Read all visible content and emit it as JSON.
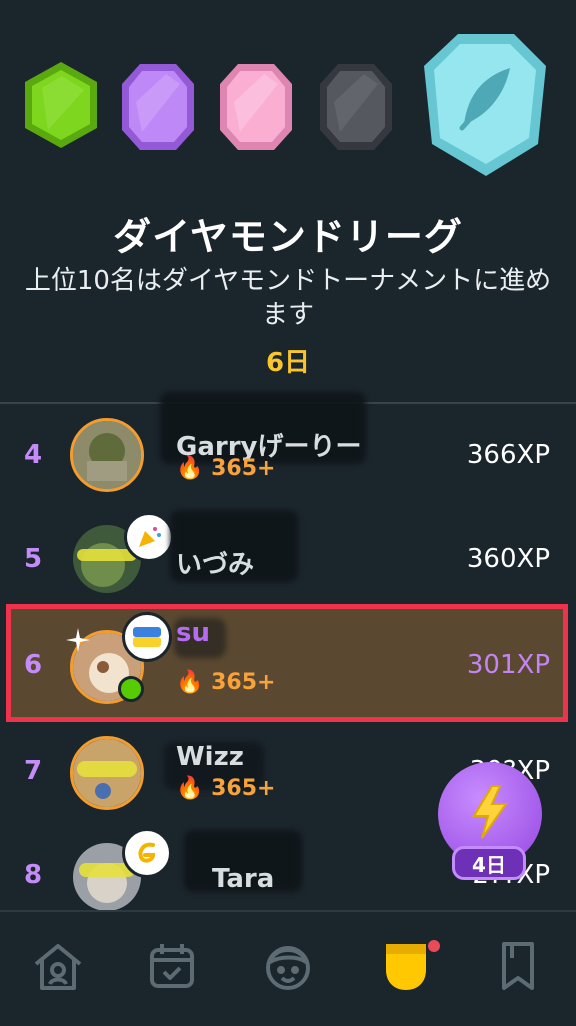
{
  "league": {
    "title": "ダイヤモンドリーグ",
    "subtitle": "上位10名はダイヤモンドトーナメントに進めます",
    "days_left": "6日",
    "gems": [
      {
        "name": "green",
        "color": "#74d317"
      },
      {
        "name": "purple",
        "color": "#b97cf4"
      },
      {
        "name": "pink",
        "color": "#f7a9cd"
      },
      {
        "name": "dark",
        "color": "#4c4f55"
      },
      {
        "name": "diamond",
        "color": "#8fe6ee"
      }
    ]
  },
  "leaderboard": [
    {
      "rank": "4",
      "name": "Garryげーりー",
      "streak": "365+",
      "xp": "366XP"
    },
    {
      "rank": "5",
      "name": "いづみ",
      "streak": "",
      "xp": "360XP"
    },
    {
      "rank": "6",
      "name": "su",
      "streak": "365+",
      "xp": "301XP",
      "highlighted": true
    },
    {
      "rank": "7",
      "name": "Wizz",
      "streak": "365+",
      "xp": "30?XP"
    },
    {
      "rank": "8",
      "name": "Tara",
      "streak": "",
      "xp": "2??XP"
    }
  ],
  "boost": {
    "days": "4日"
  },
  "nav": {
    "items": [
      {
        "icon": "home-icon"
      },
      {
        "icon": "calendar-icon"
      },
      {
        "icon": "character-icon"
      },
      {
        "icon": "league-shield-icon",
        "active": true,
        "has_notification": true
      },
      {
        "icon": "bookmark-icon"
      }
    ]
  },
  "colors": {
    "background": "#1b252c",
    "rank": "#c38cf7",
    "streak": "#f7a23b",
    "days": "#f9c52d",
    "highlight_border": "#f0334d",
    "highlight_fill": "#5b4830",
    "boost": "#b069f2"
  }
}
